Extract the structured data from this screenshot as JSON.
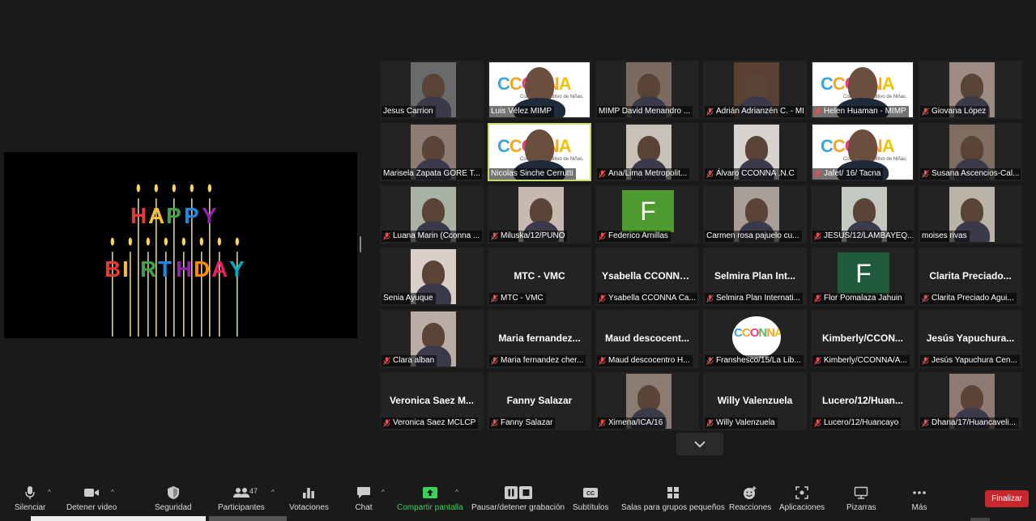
{
  "share": {
    "happy": "HAPPY",
    "birthday": "BIRTHDAY"
  },
  "tiles": [
    {
      "label": "Jesus Carrion",
      "muted": false,
      "kind": "photo",
      "bg": "#6a6a6a"
    },
    {
      "label": "Luis Vélez MIMP",
      "muted": false,
      "kind": "cconna",
      "bg": "#ffffff"
    },
    {
      "label": "MIMP David Menandro ...",
      "muted": false,
      "kind": "photo",
      "bg": "#7b6a5f"
    },
    {
      "label": "Adrián Adrianzén C. - MI...",
      "muted": true,
      "kind": "photo",
      "bg": "#5a3f33"
    },
    {
      "label": "Helen Huaman - MIMP",
      "muted": true,
      "kind": "cconna",
      "bg": "#ffffff"
    },
    {
      "label": "Giovana López",
      "muted": true,
      "kind": "photo",
      "bg": "#9d8c82"
    },
    {
      "label": "Marisela Zapata GORE T...",
      "muted": false,
      "kind": "photo",
      "bg": "#8e7c72"
    },
    {
      "label": "Nicolas Sinche Cerrutti",
      "muted": false,
      "kind": "cconna",
      "bg": "#ffffff",
      "speaking": true
    },
    {
      "label": "Ana/Lima Metropolit...",
      "muted": true,
      "kind": "photo",
      "bg": "#c9c2b9"
    },
    {
      "label": "Álvaro CCONNA .N.C",
      "muted": true,
      "kind": "photo",
      "bg": "#d8d3cf"
    },
    {
      "label": "Jafet/ 16/ Tacna",
      "muted": true,
      "kind": "cconna",
      "bg": "#ffffff"
    },
    {
      "label": "Susana Ascencios-Cal...",
      "muted": true,
      "kind": "photo",
      "bg": "#7d6e5f"
    },
    {
      "label": "Luana Marin (Cconna ...",
      "muted": true,
      "kind": "photo",
      "bg": "#a8b3a6"
    },
    {
      "label": "Miluska/12/PUNO",
      "muted": true,
      "kind": "photo",
      "bg": "#c7b9b0"
    },
    {
      "label": "Federico Arnillas",
      "muted": true,
      "kind": "avatar",
      "letter": "F",
      "bg": "#4f9a2f"
    },
    {
      "label": "Carmen rosa pajuelo cu...",
      "muted": false,
      "kind": "photo",
      "bg": "#a89e95"
    },
    {
      "label": "JESUS/12/LAMBAYEQ...",
      "muted": true,
      "kind": "photo",
      "bg": "#c3c9c0"
    },
    {
      "label": "moises rivas",
      "muted": false,
      "kind": "photo",
      "bg": "#b9b3a8"
    },
    {
      "label": "Senia Ayuque",
      "muted": false,
      "kind": "photo",
      "bg": "#d9cfc7"
    },
    {
      "label": "MTC - VMC",
      "muted": true,
      "kind": "name",
      "bigname": "MTC - VMC"
    },
    {
      "label": "Ysabella CCONNA Ca...",
      "muted": true,
      "kind": "name",
      "bigname": "Ysabella  CCONNA ..."
    },
    {
      "label": "Selmira Plan Internati...",
      "muted": true,
      "kind": "name",
      "bigname": "Selmira Plan Int..."
    },
    {
      "label": "Flor Pomalaza Jahuin",
      "muted": true,
      "kind": "avatar",
      "letter": "F",
      "bg": "#1f5a3a"
    },
    {
      "label": "Clarita Preciado Agui...",
      "muted": true,
      "kind": "name",
      "bigname": "Clarita  Preciado..."
    },
    {
      "label": "Clara alban",
      "muted": true,
      "kind": "photo",
      "bg": "#b9ada5"
    },
    {
      "label": "Maria fernandez cher...",
      "muted": true,
      "kind": "name",
      "bigname": "Maria  fernandez..."
    },
    {
      "label": "Maud descocentro H...",
      "muted": true,
      "kind": "name",
      "bigname": "Maud  descocent..."
    },
    {
      "label": "Franshesco/15/La Lib...",
      "muted": true,
      "kind": "cconna-round",
      "bg": "#232323"
    },
    {
      "label": "Kimberly/CCONNA/A...",
      "muted": true,
      "kind": "name",
      "bigname": "Kimberly/CCON..."
    },
    {
      "label": "Jesús Yapuchura Cen...",
      "muted": true,
      "kind": "name",
      "bigname": "Jesús  Yapuchura..."
    },
    {
      "label": "Veronica Saez MCLCP",
      "muted": true,
      "kind": "name",
      "bigname": "Veronica  Saez  M..."
    },
    {
      "label": "Fanny Salazar",
      "muted": true,
      "kind": "name",
      "bigname": "Fanny Salazar"
    },
    {
      "label": "Ximena/ICA/16",
      "muted": true,
      "kind": "photo",
      "bg": "#8a7c70"
    },
    {
      "label": "Willy Valenzuela",
      "muted": true,
      "kind": "name",
      "bigname": "Willy Valenzuela"
    },
    {
      "label": "Lucero/12/Huancayo",
      "muted": true,
      "kind": "name",
      "bigname": "Lucero/12/Huan..."
    },
    {
      "label": "Dhana/17/Huancaveli...",
      "muted": true,
      "kind": "photo",
      "bg": "#8e7a70"
    }
  ],
  "cconna": {
    "letters": [
      "C",
      "C",
      "O",
      "N",
      "N",
      "A"
    ],
    "sub1": "Consejo Consultivo de Niñas,",
    "sub2": "Niños y Adolescentes"
  },
  "toolbar": {
    "mute": "Silenciar",
    "video": "Detener video",
    "security": "Seguridad",
    "participants": "Participantes",
    "participants_count": "47",
    "polls": "Votaciones",
    "chat": "Chat",
    "share": "Compartir pantalla",
    "record": "Pausar/detener grabación",
    "subtitles": "Subtítulos",
    "breakout": "Salas para grupos pequeños",
    "reactions": "Reacciones",
    "apps": "Aplicaciones",
    "whiteboards": "Pizarras",
    "more": "Más",
    "end": "Finalizar"
  },
  "colors": {
    "speaking_border": "#c8d86a",
    "end_button": "#c8272d",
    "share_green": "#3ad35a"
  }
}
